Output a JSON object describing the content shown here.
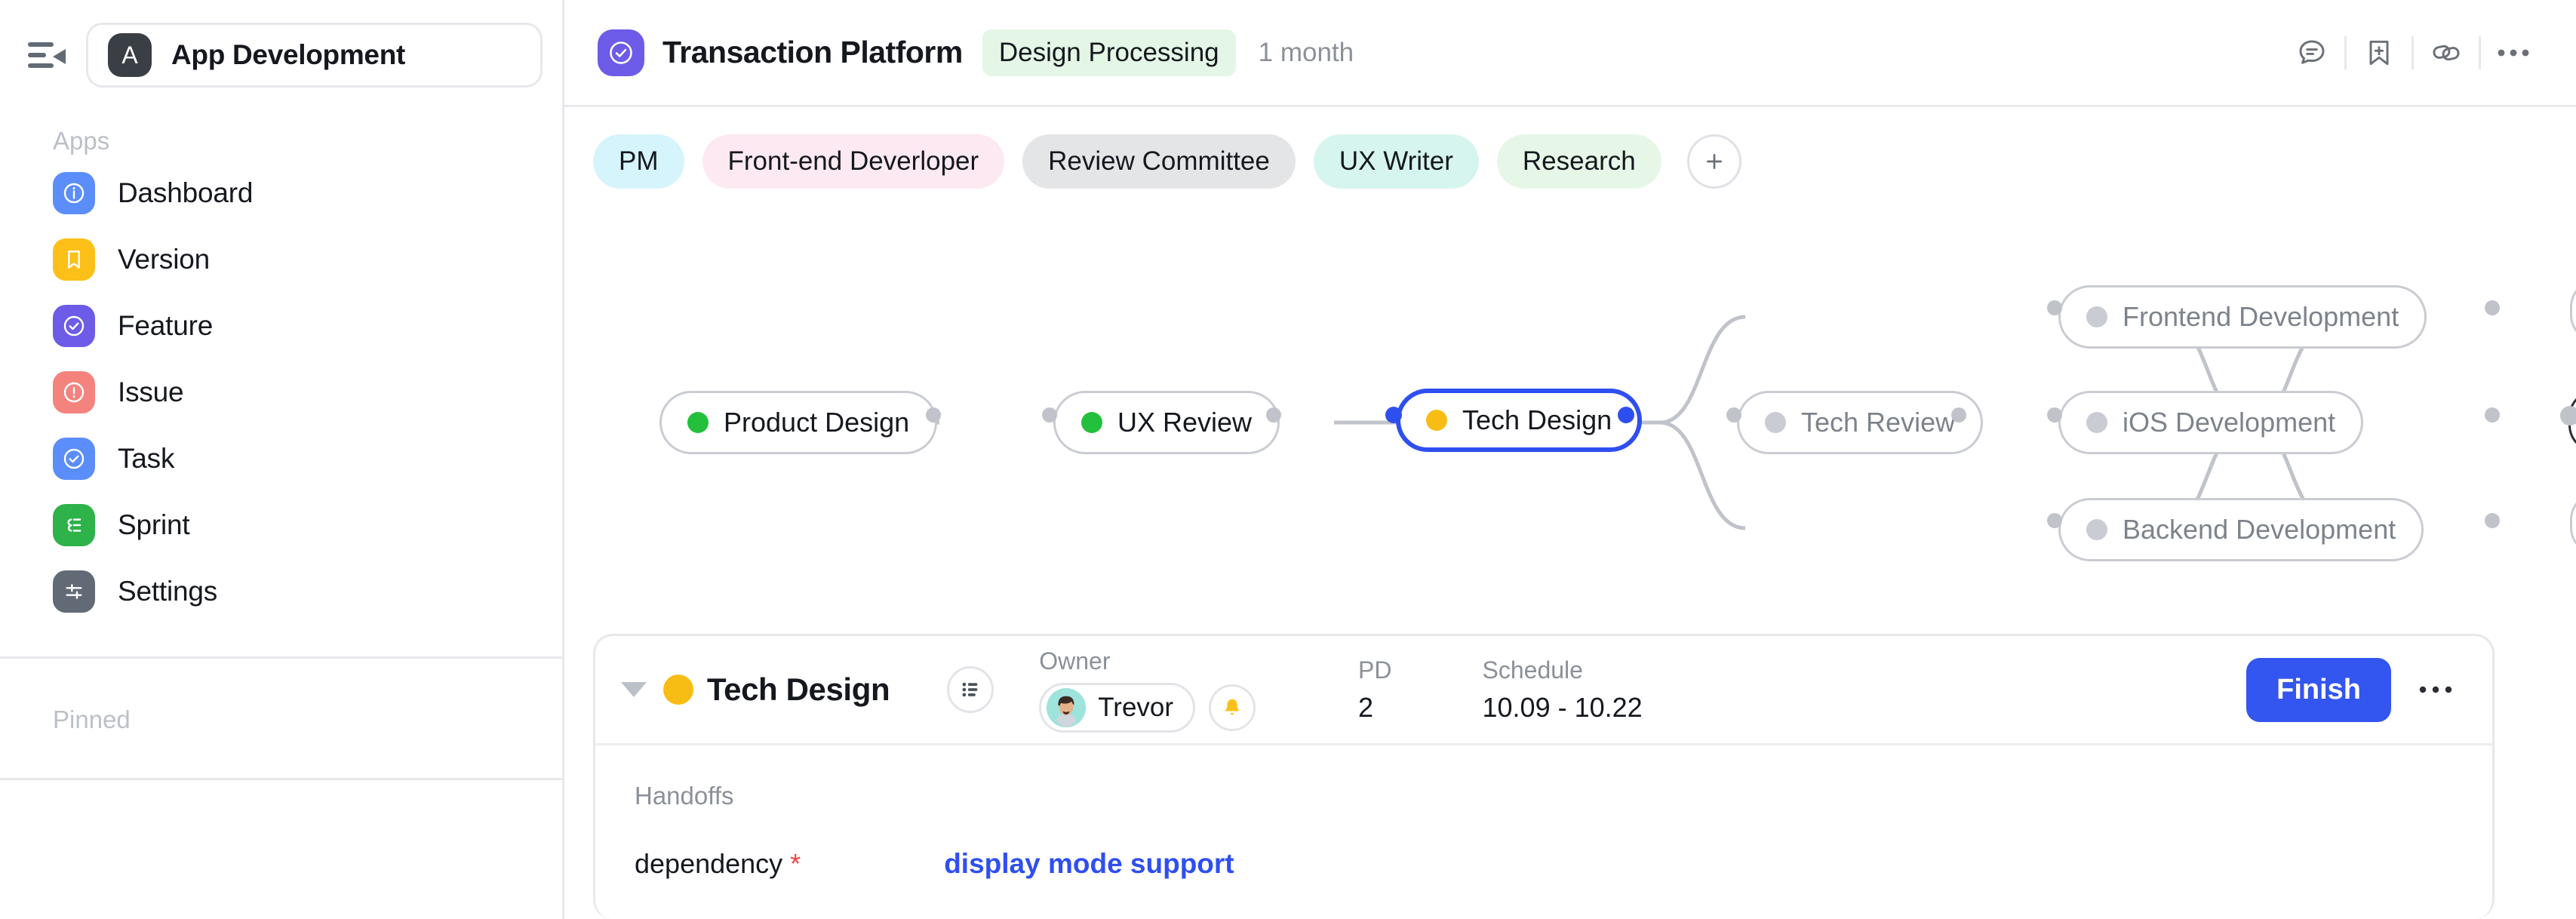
{
  "sidebar": {
    "collapse_icon": "sidebar-collapse-icon",
    "workspace": {
      "initial": "A",
      "name": "App Development"
    },
    "apps_label": "Apps",
    "pinned_label": "Pinned",
    "items": [
      {
        "label": "Dashboard",
        "icon": "info-circle-icon",
        "color": "#5b8dfb"
      },
      {
        "label": "Version",
        "icon": "bookmark-icon",
        "color": "#fcc018"
      },
      {
        "label": "Feature",
        "icon": "check-circle-icon",
        "color": "#6c5ce7"
      },
      {
        "label": "Issue",
        "icon": "alert-circle-icon",
        "color": "#f4837e"
      },
      {
        "label": "Task",
        "icon": "check-circle-icon",
        "color": "#5b8dfb"
      },
      {
        "label": "Sprint",
        "icon": "sprint-list-icon",
        "color": "#2eb24a"
      },
      {
        "label": "Settings",
        "icon": "sliders-icon",
        "color": "#626a75"
      }
    ]
  },
  "header": {
    "project_icon": "check-badge-icon",
    "title": "Transaction Platform",
    "status": "Design Processing",
    "duration": "1 month",
    "actions": [
      {
        "name": "comment-icon",
        "label": "comment"
      },
      {
        "name": "bookmark-plus-icon",
        "label": "bookmark"
      },
      {
        "name": "link-icon",
        "label": "link"
      },
      {
        "name": "more-horizontal-icon",
        "label": "more"
      }
    ]
  },
  "tags": {
    "items": [
      {
        "label": "PM",
        "bg": "#d6f4fb"
      },
      {
        "label": "Front-end Deverloper",
        "bg": "#fde9f2"
      },
      {
        "label": "Review Committee",
        "bg": "#e4e5e7"
      },
      {
        "label": "UX Writer",
        "bg": "#d6f5ee"
      },
      {
        "label": "Research",
        "bg": "#e7f7e7"
      }
    ],
    "add_label": "+"
  },
  "flow": {
    "nodes": [
      {
        "id": "product-design",
        "label": "Product Design",
        "status": "green",
        "state": "done"
      },
      {
        "id": "ux-review",
        "label": "UX Review",
        "status": "green",
        "state": "done"
      },
      {
        "id": "tech-design",
        "label": "Tech Design",
        "status": "amber",
        "state": "selected"
      },
      {
        "id": "tech-review",
        "label": "Tech Review",
        "status": "grey",
        "state": "pending"
      },
      {
        "id": "frontend-development",
        "label": "Frontend Development",
        "status": "grey",
        "state": "pending"
      },
      {
        "id": "ios-development",
        "label": "iOS Development",
        "status": "grey",
        "state": "pending"
      },
      {
        "id": "backend-development",
        "label": "Backend Development",
        "status": "grey",
        "state": "pending"
      }
    ]
  },
  "detail": {
    "title": "Tech Design",
    "status_color": "#f8bd14",
    "list_icon": "bullet-list-icon",
    "owner": {
      "label": "Owner",
      "name": "Trevor",
      "bell_icon": "bell-icon"
    },
    "pd": {
      "label": "PD",
      "value": "2"
    },
    "schedule": {
      "label": "Schedule",
      "value": "10.09 - 10.22"
    },
    "finish_label": "Finish",
    "more_icon": "more-horizontal-icon",
    "handoffs_label": "Handoffs",
    "dependency": {
      "label": "dependency",
      "required": "*",
      "value": "display mode support"
    }
  },
  "colors": {
    "accent_blue": "#2e4ff0",
    "finish_blue": "#3355f0",
    "amber": "#f8bd14",
    "green": "#22c03c",
    "border": "#e7e8ec"
  }
}
